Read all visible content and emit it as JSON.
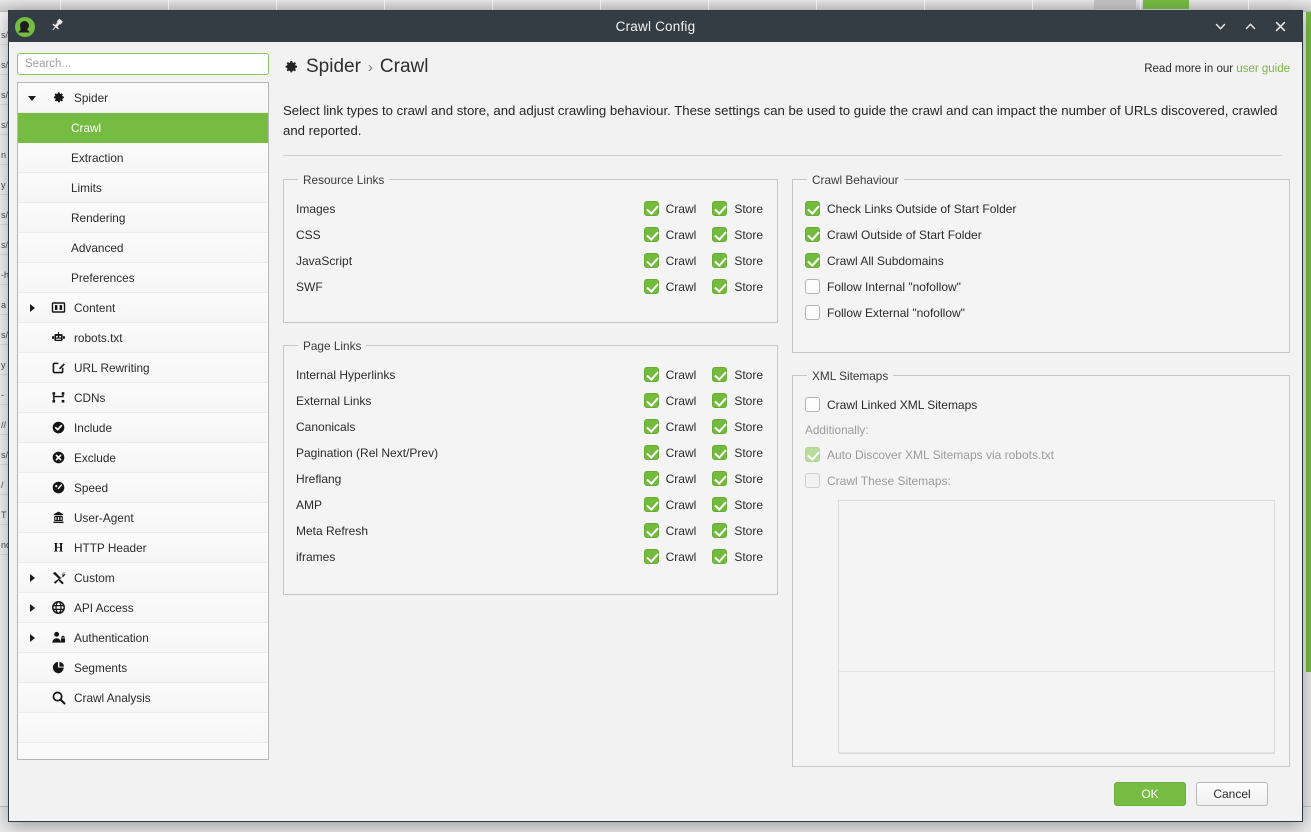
{
  "window": {
    "title": "Crawl Config",
    "logo_icon": "spider-logo-icon",
    "pin_icon": "pin-icon",
    "controls": [
      {
        "name": "minimize-button",
        "icon": "chevron-down-icon"
      },
      {
        "name": "maximize-button",
        "icon": "chevron-up-icon"
      },
      {
        "name": "close-button",
        "icon": "close-icon"
      }
    ]
  },
  "search": {
    "placeholder": "Search...",
    "value": "",
    "icon": "search-icon"
  },
  "sidebar": {
    "items": [
      {
        "label": "Spider",
        "icon": "gear-icon",
        "twisty": "expanded",
        "level": 0,
        "selected": false
      },
      {
        "label": "Crawl",
        "icon": "",
        "twisty": "",
        "level": 1,
        "selected": true
      },
      {
        "label": "Extraction",
        "icon": "",
        "twisty": "",
        "level": 1,
        "selected": false
      },
      {
        "label": "Limits",
        "icon": "",
        "twisty": "",
        "level": 1,
        "selected": false
      },
      {
        "label": "Rendering",
        "icon": "",
        "twisty": "",
        "level": 1,
        "selected": false
      },
      {
        "label": "Advanced",
        "icon": "",
        "twisty": "",
        "level": 1,
        "selected": false
      },
      {
        "label": "Preferences",
        "icon": "",
        "twisty": "",
        "level": 1,
        "selected": false
      },
      {
        "label": "Content",
        "icon": "columns-icon",
        "twisty": "collapsed",
        "level": 0,
        "selected": false
      },
      {
        "label": "robots.txt",
        "icon": "robot-icon",
        "twisty": "",
        "level": 0,
        "selected": false
      },
      {
        "label": "URL Rewriting",
        "icon": "edit-square-icon",
        "twisty": "",
        "level": 0,
        "selected": false
      },
      {
        "label": "CDNs",
        "icon": "network-icon",
        "twisty": "",
        "level": 0,
        "selected": false
      },
      {
        "label": "Include",
        "icon": "check-circle-icon",
        "twisty": "",
        "level": 0,
        "selected": false
      },
      {
        "label": "Exclude",
        "icon": "x-circle-icon",
        "twisty": "",
        "level": 0,
        "selected": false
      },
      {
        "label": "Speed",
        "icon": "gauge-icon",
        "twisty": "",
        "level": 0,
        "selected": false
      },
      {
        "label": "User-Agent",
        "icon": "robot-head-icon",
        "twisty": "",
        "level": 0,
        "selected": false
      },
      {
        "label": "HTTP Header",
        "icon": "letter-h-icon",
        "twisty": "",
        "level": 0,
        "selected": false
      },
      {
        "label": "Custom",
        "icon": "tools-icon",
        "twisty": "collapsed",
        "level": 0,
        "selected": false
      },
      {
        "label": "API Access",
        "icon": "globe-icon",
        "twisty": "collapsed",
        "level": 0,
        "selected": false
      },
      {
        "label": "Authentication",
        "icon": "user-lock-icon",
        "twisty": "collapsed",
        "level": 0,
        "selected": false
      },
      {
        "label": "Segments",
        "icon": "pie-chart-icon",
        "twisty": "",
        "level": 0,
        "selected": false
      },
      {
        "label": "Crawl Analysis",
        "icon": "magnifier-icon",
        "twisty": "",
        "level": 0,
        "selected": false
      }
    ]
  },
  "header": {
    "gear_icon": "gear-icon",
    "breadcrumb_parent": "Spider",
    "breadcrumb_separator": "›",
    "breadcrumb_current": "Crawl",
    "readmore_text": "Read more in our",
    "readmore_link": "user guide"
  },
  "description": "Select link types to crawl and store, and adjust crawling behaviour. These settings can be used to guide the crawl and can impact the number of URLs discovered, crawled and reported.",
  "labels": {
    "crawl": "Crawl",
    "store": "Store"
  },
  "resource_links": {
    "legend": "Resource Links",
    "rows": [
      {
        "label": "Images",
        "crawl": true,
        "store": true
      },
      {
        "label": "CSS",
        "crawl": true,
        "store": true
      },
      {
        "label": "JavaScript",
        "crawl": true,
        "store": true
      },
      {
        "label": "SWF",
        "crawl": true,
        "store": true
      }
    ]
  },
  "page_links": {
    "legend": "Page Links",
    "rows": [
      {
        "label": "Internal Hyperlinks",
        "crawl": true,
        "store": true
      },
      {
        "label": "External Links",
        "crawl": true,
        "store": true
      },
      {
        "label": "Canonicals",
        "crawl": true,
        "store": true
      },
      {
        "label": "Pagination (Rel Next/Prev)",
        "crawl": true,
        "store": true
      },
      {
        "label": "Hreflang",
        "crawl": true,
        "store": true
      },
      {
        "label": "AMP",
        "crawl": true,
        "store": true
      },
      {
        "label": "Meta Refresh",
        "crawl": true,
        "store": true
      },
      {
        "label": "iframes",
        "crawl": true,
        "store": true
      }
    ]
  },
  "crawl_behaviour": {
    "legend": "Crawl Behaviour",
    "rows": [
      {
        "label": "Check Links Outside of Start Folder",
        "checked": true
      },
      {
        "label": "Crawl Outside of Start Folder",
        "checked": true
      },
      {
        "label": "Crawl All Subdomains",
        "checked": true
      },
      {
        "label": "Follow Internal \"nofollow\"",
        "checked": false
      },
      {
        "label": "Follow External \"nofollow\"",
        "checked": false
      }
    ]
  },
  "xml_sitemaps": {
    "legend": "XML Sitemaps",
    "crawl_linked": {
      "label": "Crawl Linked XML Sitemaps",
      "checked": false
    },
    "additionally_label": "Additionally:",
    "auto_discover": {
      "label": "Auto Discover XML Sitemaps via robots.txt",
      "checked": true,
      "disabled": true
    },
    "crawl_these": {
      "label": "Crawl These Sitemaps:",
      "checked": false,
      "disabled": true
    },
    "textarea_value": "",
    "textarea2_value": ""
  },
  "footer": {
    "ok_label": "OK",
    "cancel_label": "Cancel"
  },
  "colors": {
    "accent_green": "#76bc43",
    "titlebar": "#343d44",
    "checkbox_on": "#72bb3c",
    "link_green": "#7cb342"
  }
}
